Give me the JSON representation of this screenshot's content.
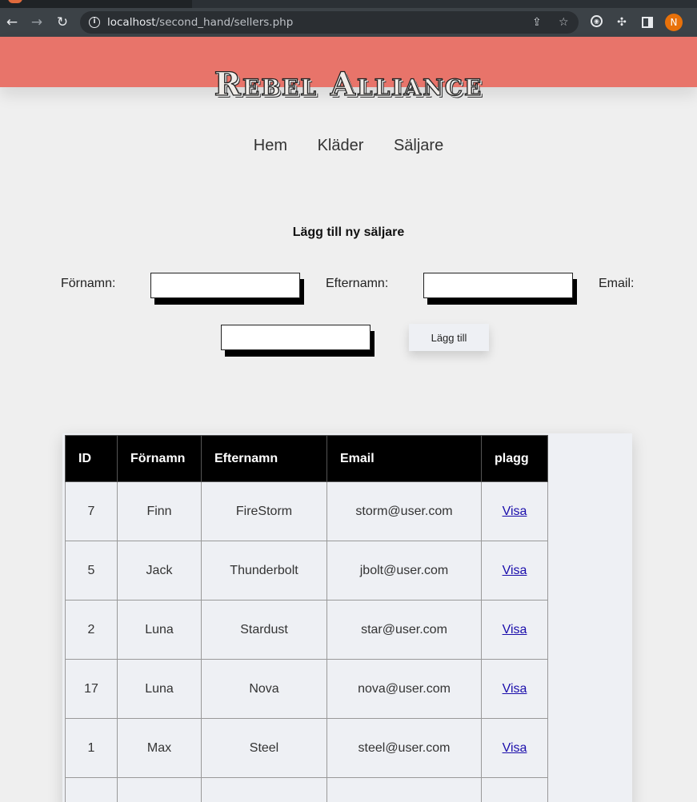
{
  "browser": {
    "url_host": "localhost",
    "url_path": "/second_hand/sellers.php",
    "profile_initial": "N"
  },
  "site": {
    "logo": "Rebel Alliance",
    "nav": [
      "Hem",
      "Kläder",
      "Säljare"
    ]
  },
  "form": {
    "title": "Lägg till ny säljare",
    "firstname_label": "Förnamn:",
    "lastname_label": "Efternamn:",
    "email_label": "Email:",
    "submit_label": "Lägg till"
  },
  "table": {
    "headers": [
      "ID",
      "Förnamn",
      "Efternamn",
      "Email",
      "plagg"
    ],
    "rows": [
      {
        "id": "7",
        "first": "Finn",
        "last": "FireStorm",
        "email": "storm@user.com",
        "link": "Visa"
      },
      {
        "id": "5",
        "first": "Jack",
        "last": "Thunderbolt",
        "email": "jbolt@user.com",
        "link": "Visa"
      },
      {
        "id": "2",
        "first": "Luna",
        "last": "Stardust",
        "email": "star@user.com",
        "link": "Visa"
      },
      {
        "id": "17",
        "first": "Luna",
        "last": "Nova",
        "email": "nova@user.com",
        "link": "Visa"
      },
      {
        "id": "1",
        "first": "Max",
        "last": "Steel",
        "email": "steel@user.com",
        "link": "Visa"
      },
      {
        "id": "",
        "first": "",
        "last": "",
        "email": "",
        "link": ""
      }
    ]
  },
  "colors": {
    "header_band": "#e8746a",
    "table_header": "#000000",
    "link": "#1a0dab"
  }
}
